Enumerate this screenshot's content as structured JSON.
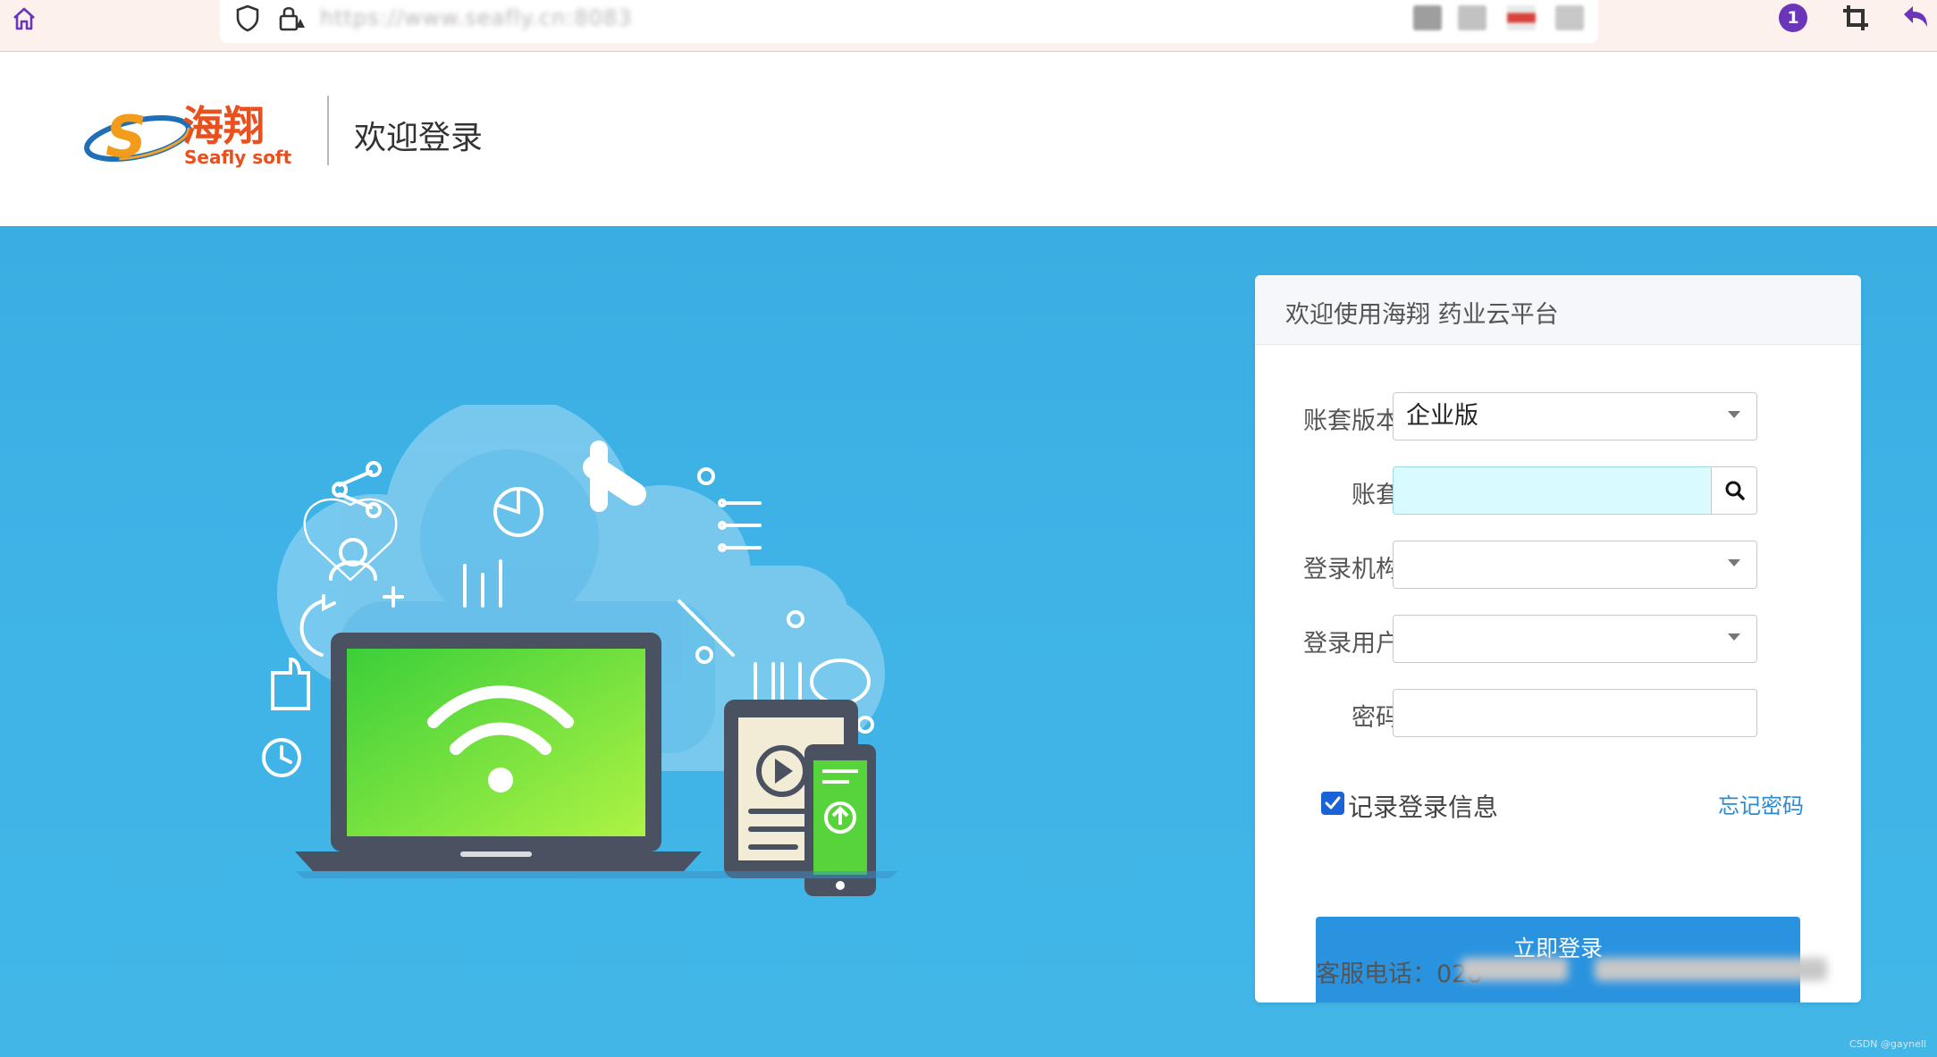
{
  "browser": {
    "url_text": "https://www.seafly.cn:8083",
    "extension_badge_count": "1",
    "extension_colors": [
      "#9e9e9e",
      "#b5b5b5",
      "#d9423b",
      "#c5c5c5"
    ]
  },
  "header": {
    "logo_text_cn": "海翔",
    "logo_text_en": "Seafly soft",
    "page_title": "欢迎登录"
  },
  "login_card": {
    "title": "欢迎使用海翔 药业云平台",
    "fields": {
      "edition_label": "账套版本",
      "edition_value": "企业版",
      "account_label": "账套",
      "account_value": "",
      "org_label": "登录机构",
      "org_value": "",
      "user_label": "登录用户",
      "user_value": "",
      "password_label": "密码",
      "password_value": ""
    },
    "remember_label": "记录登录信息",
    "remember_checked": true,
    "forgot_label": "忘记密码",
    "login_button_label": "立即登录",
    "service_phone_label": "客服电话：028"
  },
  "watermark": "CSDN @gaynell",
  "colors": {
    "hero_background": "#3fb3e6",
    "primary_button": "#2a93e0",
    "link": "#2a8ad4",
    "account_field_bg": "#d9fbff",
    "checkbox": "#1b62d6",
    "browser_accent": "#6a35b9"
  }
}
